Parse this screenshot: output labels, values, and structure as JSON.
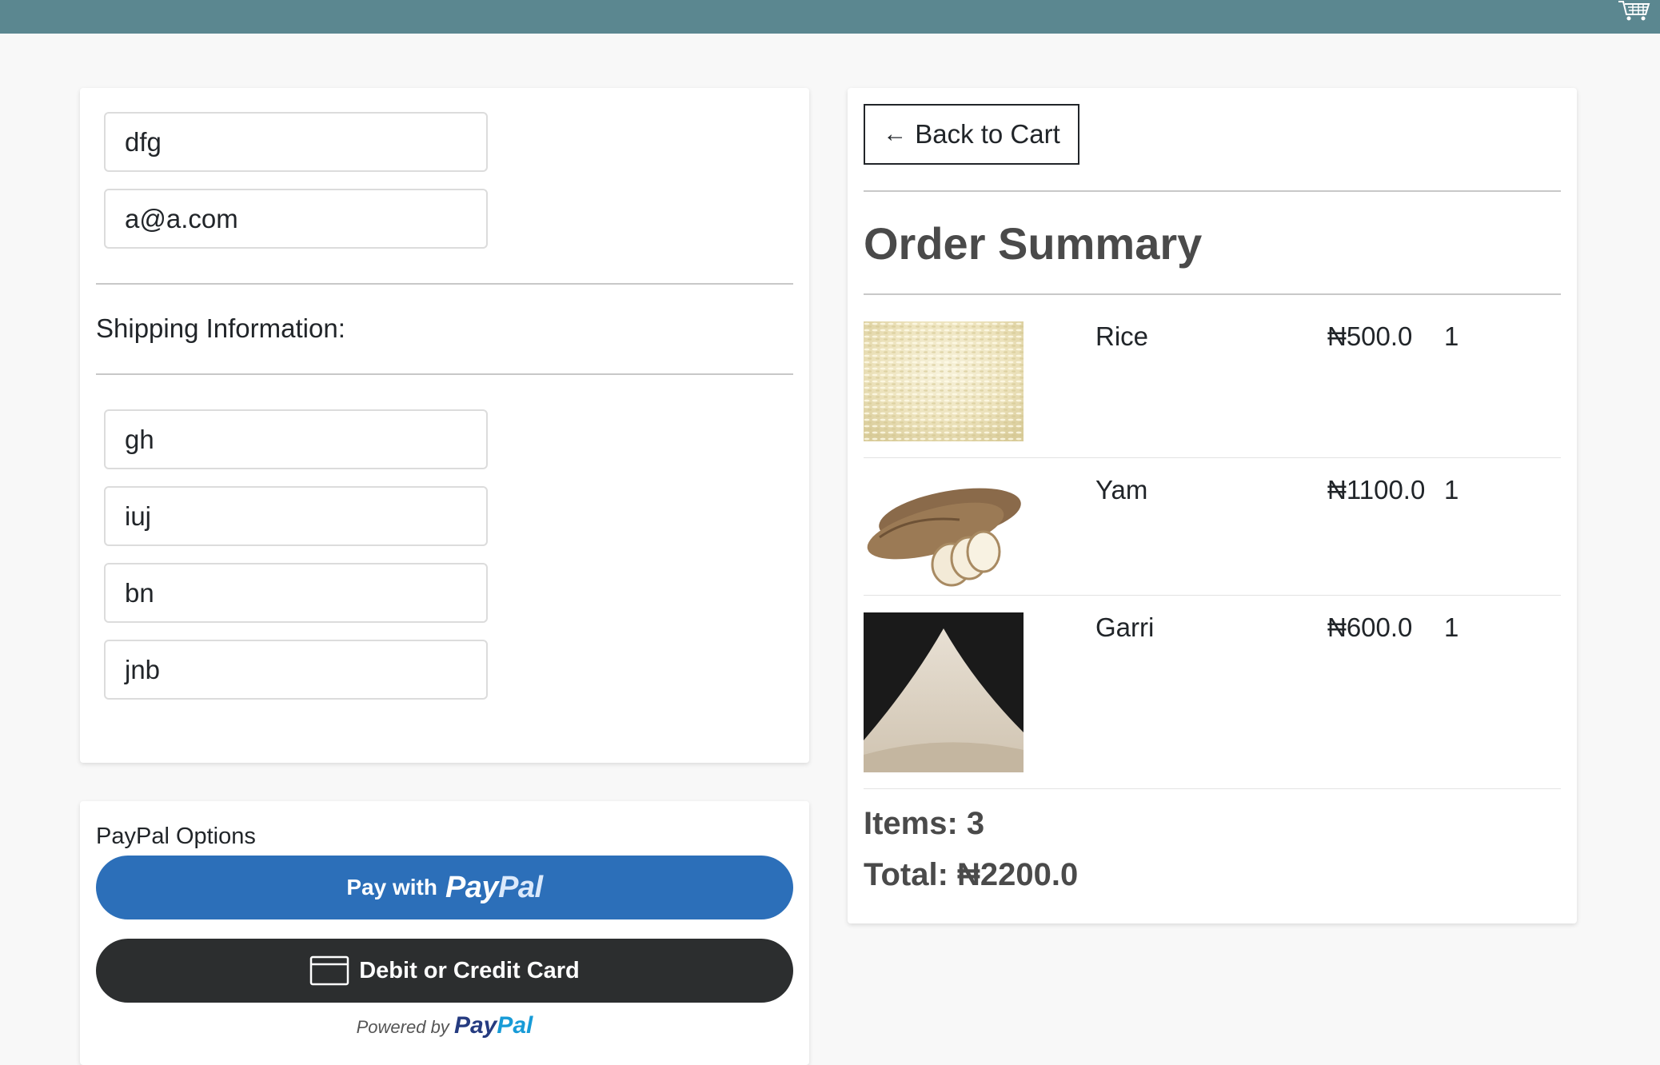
{
  "colors": {
    "topbar": "#5b8790",
    "paypal_button": "#2c6fb9",
    "card_button": "#2c2e2f",
    "paypal_dark": "#253b80",
    "paypal_light": "#179bd7"
  },
  "header": {
    "cart_icon": "cart-icon"
  },
  "form": {
    "name_value": "dfg",
    "email_value": "a@a.com",
    "shipping_label": "Shipping Information:",
    "address_value": "gh",
    "city_value": "iuj",
    "state_value": "bn",
    "zip_value": "jnb"
  },
  "payment": {
    "label": "PayPal Options",
    "paypal_button": {
      "prefix": "Pay with",
      "logo_pay": "Pay",
      "logo_pal": "Pal"
    },
    "card_button": {
      "label": "Debit or Credit Card",
      "icon": "credit-card-icon"
    },
    "powered": {
      "prefix": "Powered by",
      "logo_pay": "Pay",
      "logo_pal": "Pal"
    }
  },
  "summary": {
    "back_label": "Back to Cart",
    "back_icon": "arrow-left-icon",
    "title": "Order Summary",
    "items": [
      {
        "name": "Rice",
        "price": "₦500.0",
        "qty": "1",
        "image": "rice"
      },
      {
        "name": "Yam",
        "price": "₦1100.0",
        "qty": "1",
        "image": "yam"
      },
      {
        "name": "Garri",
        "price": "₦600.0",
        "qty": "1",
        "image": "garri"
      }
    ],
    "items_text": "Items: 3",
    "total_text": "Total: ₦2200.0"
  }
}
